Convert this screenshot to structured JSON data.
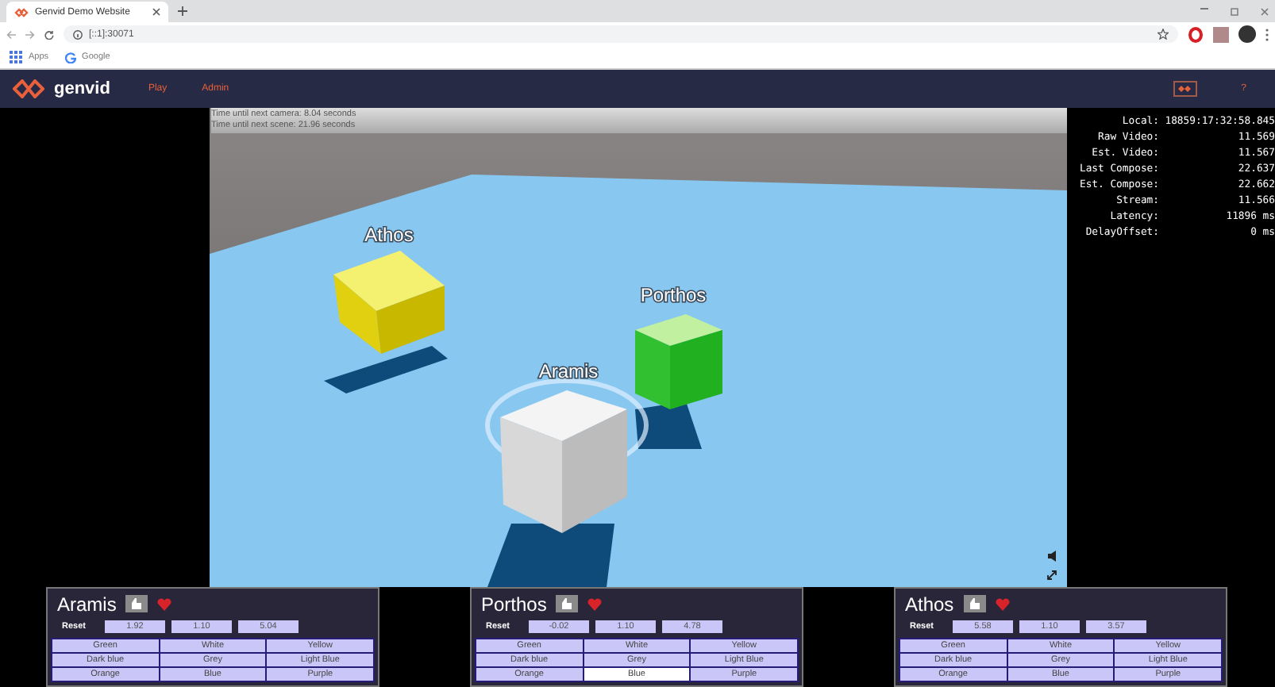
{
  "browser": {
    "tab_title": "Genvid Demo Website",
    "url": "[::1]:30071",
    "bookmarks": [
      "Apps",
      "Google"
    ]
  },
  "nav": {
    "brand": "genvid",
    "links": [
      "Play",
      "Admin"
    ],
    "help": "?"
  },
  "video": {
    "overlay": [
      "Time until next camera: 8.04 seconds",
      "Time until next scene: 21.96 seconds"
    ],
    "labels": [
      "Athos",
      "Porthos",
      "Aramis"
    ]
  },
  "stats": [
    {
      "label": "Local:",
      "value": "18859:17:32:58.845"
    },
    {
      "label": "Raw Video:",
      "value": "11.569"
    },
    {
      "label": "Est. Video:",
      "value": "11.567"
    },
    {
      "label": "Last Compose:",
      "value": "22.637"
    },
    {
      "label": "Est. Compose:",
      "value": "22.662"
    },
    {
      "label": "Stream:",
      "value": "11.566"
    },
    {
      "label": "Latency:",
      "value": "11896 ms"
    },
    {
      "label": "DelayOffset:",
      "value": "0 ms"
    }
  ],
  "panels": [
    {
      "name": "Aramis",
      "reset": "Reset",
      "values": [
        "1.92",
        "1.10",
        "5.04"
      ],
      "colors": [
        {
          "label": "Green",
          "selected": false
        },
        {
          "label": "White",
          "selected": false
        },
        {
          "label": "Yellow",
          "selected": false
        },
        {
          "label": "Dark blue",
          "selected": false
        },
        {
          "label": "Grey",
          "selected": false
        },
        {
          "label": "Light Blue",
          "selected": false
        },
        {
          "label": "Orange",
          "selected": false
        },
        {
          "label": "Blue",
          "selected": false
        },
        {
          "label": "Purple",
          "selected": false
        }
      ]
    },
    {
      "name": "Porthos",
      "reset": "Reset",
      "values": [
        "-0.02",
        "1.10",
        "4.78"
      ],
      "colors": [
        {
          "label": "Green",
          "selected": false
        },
        {
          "label": "White",
          "selected": false
        },
        {
          "label": "Yellow",
          "selected": false
        },
        {
          "label": "Dark blue",
          "selected": false
        },
        {
          "label": "Grey",
          "selected": false
        },
        {
          "label": "Light Blue",
          "selected": false
        },
        {
          "label": "Orange",
          "selected": false
        },
        {
          "label": "Blue",
          "selected": true
        },
        {
          "label": "Purple",
          "selected": false
        }
      ]
    },
    {
      "name": "Athos",
      "reset": "Reset",
      "values": [
        "5.58",
        "1.10",
        "3.57"
      ],
      "colors": [
        {
          "label": "Green",
          "selected": false
        },
        {
          "label": "White",
          "selected": false
        },
        {
          "label": "Yellow",
          "selected": false
        },
        {
          "label": "Dark blue",
          "selected": false
        },
        {
          "label": "Grey",
          "selected": false
        },
        {
          "label": "Light Blue",
          "selected": false
        },
        {
          "label": "Orange",
          "selected": false
        },
        {
          "label": "Blue",
          "selected": false
        },
        {
          "label": "Purple",
          "selected": false
        }
      ]
    }
  ]
}
